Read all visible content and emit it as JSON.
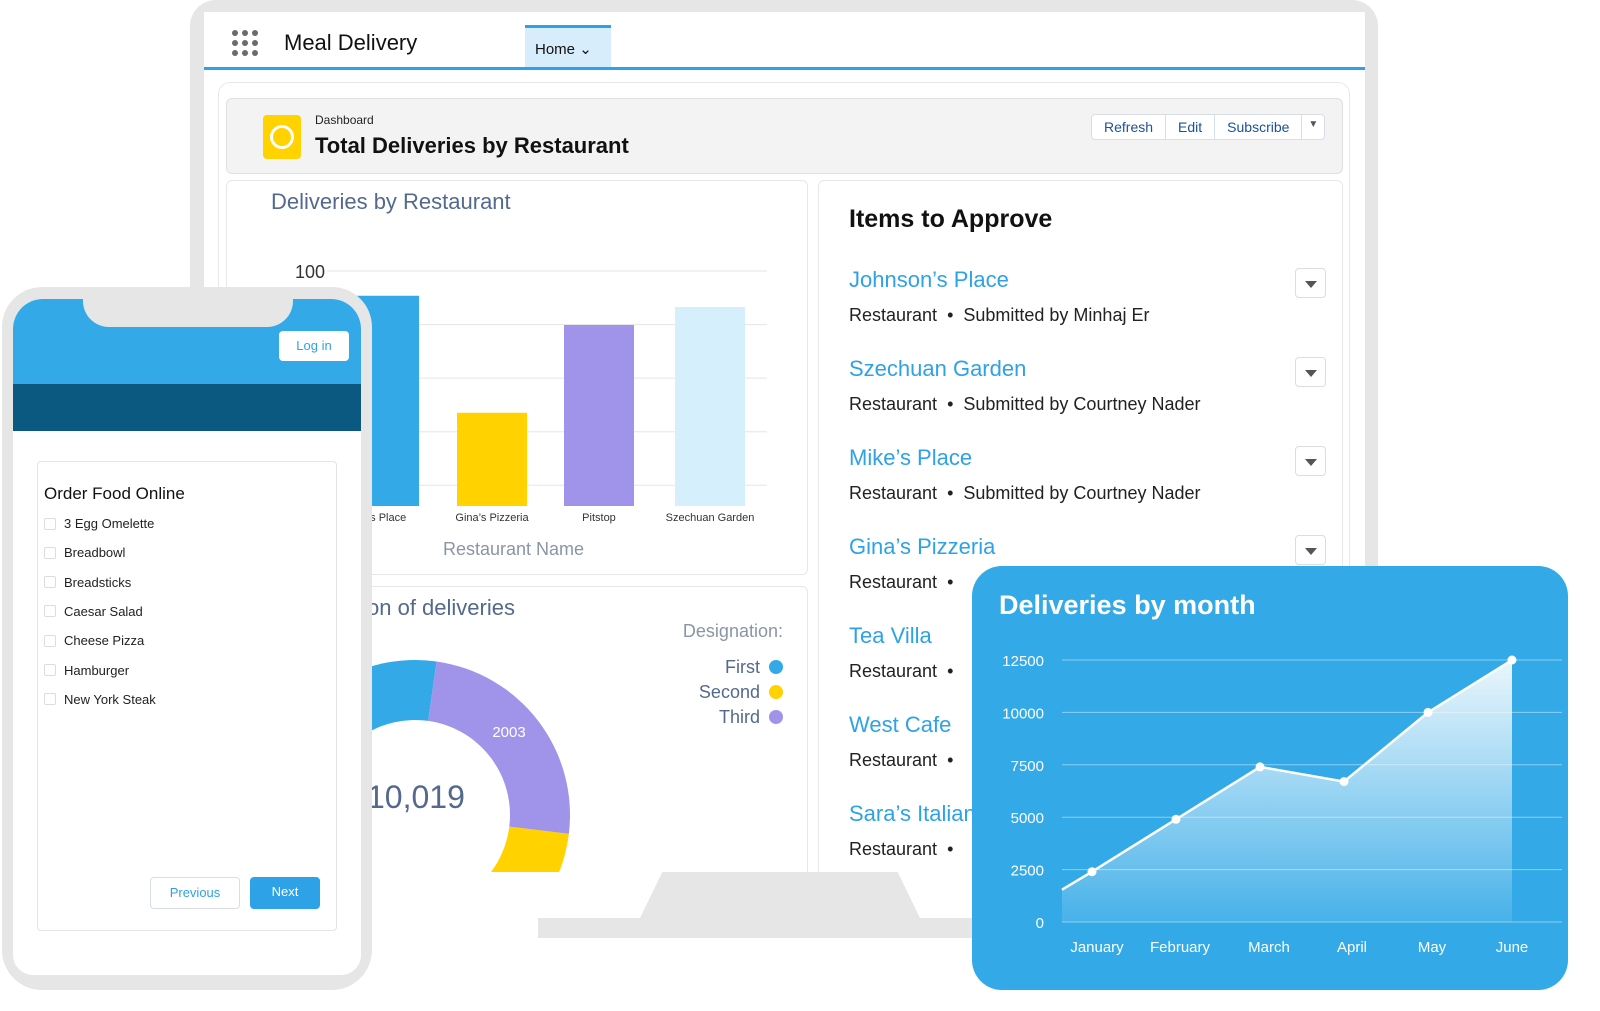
{
  "app": {
    "title": "Meal Delivery",
    "tab": "Home",
    "menu_icon": "app-launcher-icon"
  },
  "dashboard": {
    "label": "Dashboard",
    "title": "Total Deliveries by Restaurant",
    "buttons": [
      "Refresh",
      "Edit",
      "Subscribe"
    ]
  },
  "approvals": {
    "title": "Items to Approve",
    "items": [
      {
        "name": "Johnson’s Place",
        "type": "Restaurant",
        "submitted": "Submitted by Minhaj Er"
      },
      {
        "name": "Szechuan Garden",
        "type": "Restaurant",
        "submitted": "Submitted by Courtney Nader"
      },
      {
        "name": "Mike’s Place",
        "type": "Restaurant",
        "submitted": "Submitted by Courtney Nader"
      },
      {
        "name": "Gina’s Pizzeria",
        "type": "Restaurant",
        "submitted": ""
      },
      {
        "name": "Tea Villa",
        "type": "Restaurant",
        "submitted": ""
      },
      {
        "name": "West Cafe",
        "type": "Restaurant",
        "submitted": ""
      },
      {
        "name": "Sara’s Italian",
        "type": "Restaurant",
        "submitted": ""
      }
    ]
  },
  "phone": {
    "login": "Log in",
    "form_title": "Order Food Online",
    "options": [
      "3 Egg Omelette",
      "Breadbowl",
      "Breadsticks",
      "Caesar Salad",
      "Cheese Pizza",
      "Hamburger",
      "New York Steak"
    ],
    "previous": "Previous",
    "next": "Next"
  },
  "chart_data": [
    {
      "type": "bar",
      "title": "Deliveries by Restaurant",
      "xlabel": "Restaurant Name",
      "ylim": [
        0,
        100
      ],
      "yticks": [
        "100"
      ],
      "categories": [
        "Johnson’s Place",
        "Gina’s Pizzeria",
        "Pitstop",
        "Szechuan Garden"
      ],
      "visible_labels": [
        "e’s Place",
        "Gina’s Pizzeria",
        "Pitstop",
        "Szechuan Garden"
      ],
      "values": [
        89,
        37,
        76,
        84
      ],
      "colors": [
        "#33a9e7",
        "#ffd200",
        "#a094ea",
        "#d6effc"
      ]
    },
    {
      "type": "pie",
      "title": "on of deliveries",
      "total": "10,019",
      "legend_title": "Designation:",
      "legend": [
        {
          "name": "First",
          "color": "#33a9e7"
        },
        {
          "name": "Second",
          "color": "#ffd200"
        },
        {
          "name": "Third",
          "color": "#a094ea"
        }
      ],
      "data_labels": {
        "Third": "2003"
      }
    },
    {
      "type": "area",
      "title": "Deliveries by month",
      "categories": [
        "January",
        "February",
        "March",
        "April",
        "May",
        "June"
      ],
      "values": [
        2400,
        4900,
        7400,
        6700,
        10000,
        12500
      ],
      "ylim": [
        0,
        12500
      ],
      "yticks": [
        "0",
        "2500",
        "5000",
        "7500",
        "10000",
        "12500"
      ],
      "grid": true
    }
  ]
}
